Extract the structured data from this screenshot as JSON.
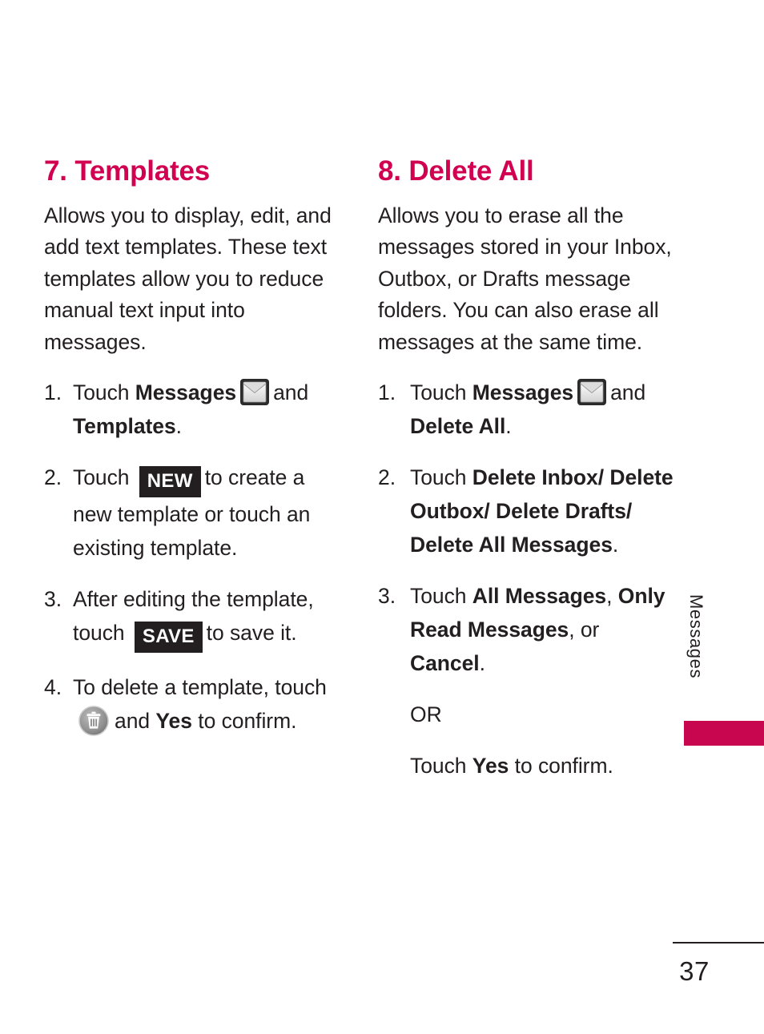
{
  "page": {
    "number": "37",
    "side_tab_label": "Messages",
    "accent_color": "#d10051",
    "tab_color": "#c8054f",
    "text_color": "#231f20"
  },
  "icons": {
    "envelope": "envelope-icon",
    "trash": "trash-icon"
  },
  "left_column": {
    "title": "7. Templates",
    "intro": "Allows you to display, edit, and add text templates. These text templates allow you to reduce manual text input into messages.",
    "steps": [
      {
        "num": "1.",
        "parts": [
          {
            "type": "text",
            "value": "Touch "
          },
          {
            "type": "bold",
            "value": "Messages"
          },
          {
            "type": "icon",
            "value": "envelope-icon"
          },
          {
            "type": "text",
            "value": "and "
          },
          {
            "type": "bold",
            "value": "Templates"
          },
          {
            "type": "text",
            "value": "."
          }
        ]
      },
      {
        "num": "2.",
        "parts": [
          {
            "type": "text",
            "value": "Touch "
          },
          {
            "type": "keycap",
            "value": "NEW"
          },
          {
            "type": "text",
            "value": "to create a new template or touch an existing template."
          }
        ]
      },
      {
        "num": "3.",
        "parts": [
          {
            "type": "text",
            "value": "After editing the template, touch "
          },
          {
            "type": "keycap",
            "value": "SAVE"
          },
          {
            "type": "text",
            "value": "to save it."
          }
        ]
      },
      {
        "num": "4.",
        "parts": [
          {
            "type": "text",
            "value": "To delete a template, touch "
          },
          {
            "type": "icon",
            "value": "trash-icon"
          },
          {
            "type": "text",
            "value": "and "
          },
          {
            "type": "bold",
            "value": "Yes"
          },
          {
            "type": "text",
            "value": " to confirm."
          }
        ]
      }
    ]
  },
  "right_column": {
    "title": "8. Delete All",
    "intro": "Allows you to erase all the messages stored in your Inbox, Outbox, or Drafts message folders. You can also erase all messages at the same time.",
    "steps": [
      {
        "num": "1.",
        "parts": [
          {
            "type": "text",
            "value": "Touch "
          },
          {
            "type": "bold",
            "value": "Messages"
          },
          {
            "type": "icon",
            "value": "envelope-icon"
          },
          {
            "type": "text",
            "value": "and "
          },
          {
            "type": "bold",
            "value": "Delete All"
          },
          {
            "type": "text",
            "value": "."
          }
        ]
      },
      {
        "num": "2.",
        "parts": [
          {
            "type": "text",
            "value": "Touch "
          },
          {
            "type": "bold",
            "value": "Delete Inbox/ Delete Outbox/ Delete Drafts/ Delete All Messages"
          },
          {
            "type": "text",
            "value": "."
          }
        ]
      },
      {
        "num": "3.",
        "parts": [
          {
            "type": "text",
            "value": "Touch "
          },
          {
            "type": "bold",
            "value": "All Messages"
          },
          {
            "type": "text",
            "value": ", "
          },
          {
            "type": "bold",
            "value": "Only Read Messages"
          },
          {
            "type": "text",
            "value": ", or "
          },
          {
            "type": "bold",
            "value": "Cancel"
          },
          {
            "type": "text",
            "value": "."
          }
        ]
      }
    ],
    "or_label": "OR",
    "confirm_parts": [
      {
        "type": "text",
        "value": "Touch "
      },
      {
        "type": "bold",
        "value": "Yes"
      },
      {
        "type": "text",
        "value": " to confirm."
      }
    ]
  }
}
